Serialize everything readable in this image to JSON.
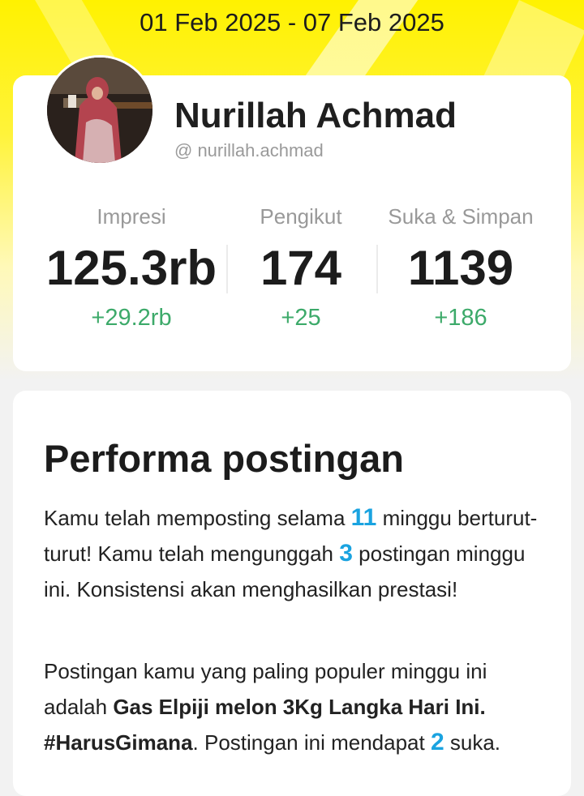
{
  "header": {
    "date_range": "01 Feb 2025 - 07 Feb 2025"
  },
  "profile": {
    "name": "Nurillah Achmad",
    "handle": "@ nurillah.achmad"
  },
  "stats": [
    {
      "label": "Impresi",
      "value": "125.3rb",
      "delta": "+29.2rb"
    },
    {
      "label": "Pengikut",
      "value": "174",
      "delta": "+25"
    },
    {
      "label": "Suka & Simpan",
      "value": "1139",
      "delta": "+186"
    }
  ],
  "performance": {
    "title": "Performa postingan",
    "p1_a": "Kamu telah memposting selama ",
    "p1_weeks": "11",
    "p1_b": " minggu berturut-turut! Kamu telah mengunggah ",
    "p1_posts": "3",
    "p1_c": " postingan minggu ini. Konsistensi akan menghasilkan prestasi!",
    "p2_a": "Postingan kamu yang paling populer minggu ini adalah ",
    "p2_post_title": "Gas Elpiji melon 3Kg Langka Hari Ini. #HarusGimana",
    "p2_b": ". Postingan ini mendapat ",
    "p2_likes": "2",
    "p2_c": " suka."
  },
  "colors": {
    "accent_yellow": "#fff200",
    "highlight_blue": "#1aa3e0",
    "delta_green": "#3daa6a"
  }
}
